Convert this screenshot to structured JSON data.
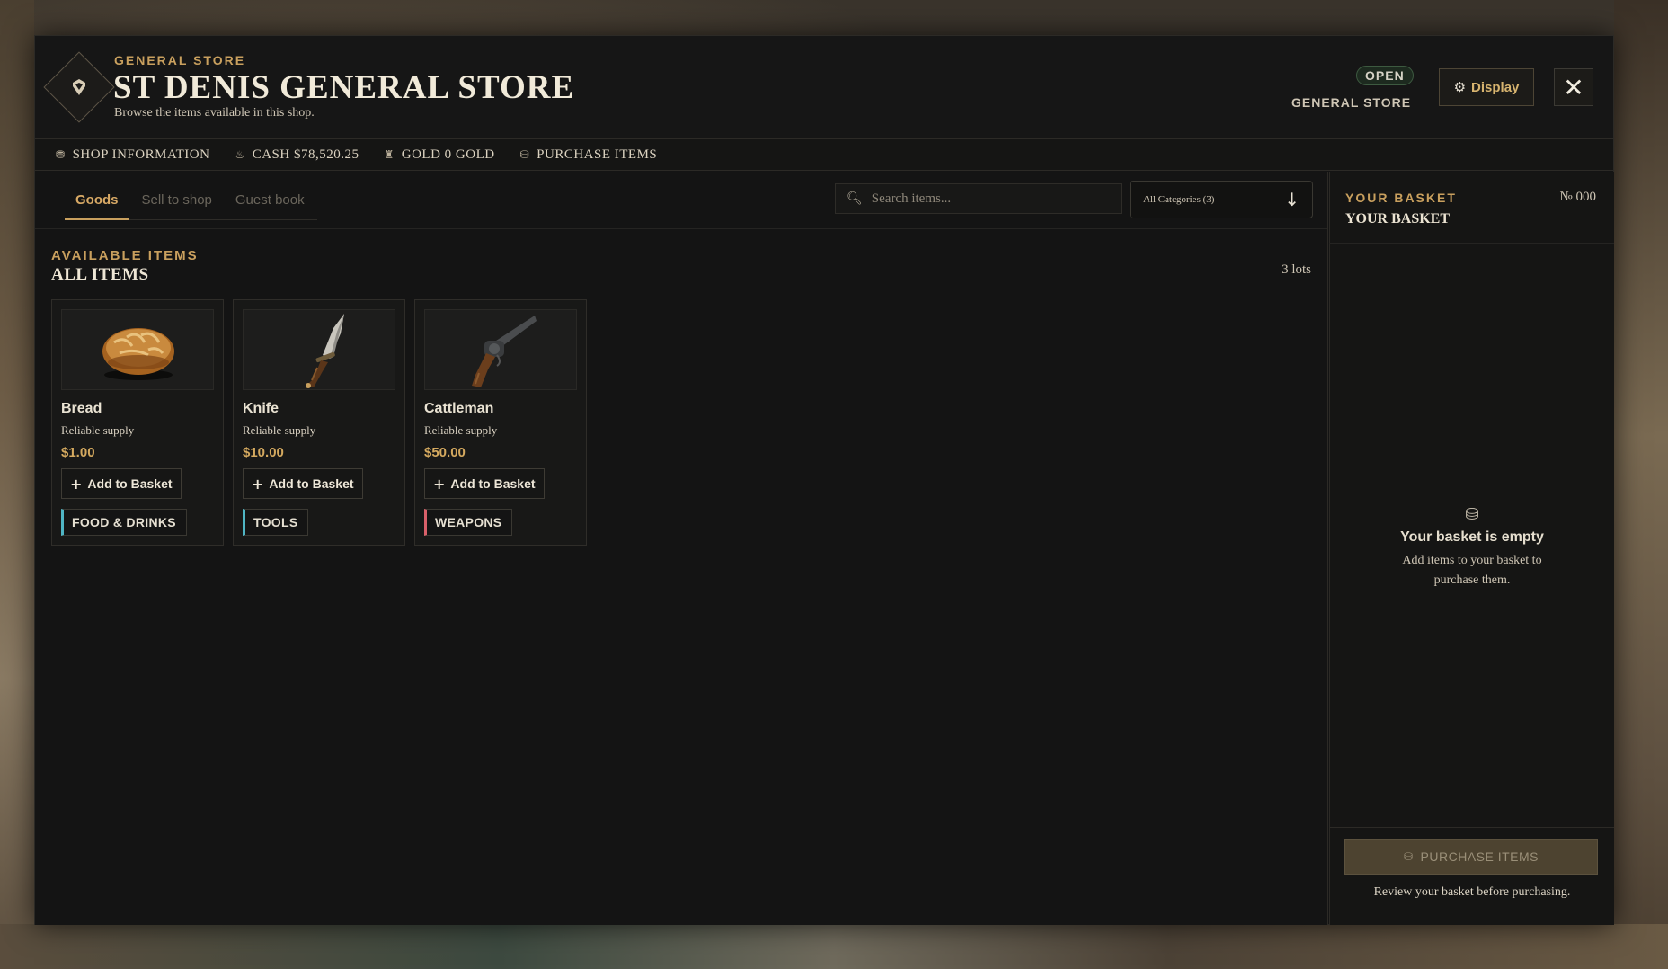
{
  "header": {
    "eyebrow": "GENERAL STORE",
    "title": "ST DENIS GENERAL STORE",
    "subtitle": "Browse the items available in this shop.",
    "status": "OPEN",
    "store_type": "GENERAL STORE",
    "display_label": "Display",
    "close_symbol": "✕"
  },
  "infobar": [
    {
      "icon": "shop-info-icon",
      "glyph": "⛃",
      "label": "SHOP INFORMATION"
    },
    {
      "icon": "cash-icon",
      "glyph": "♨",
      "label": "CASH $78,520.25"
    },
    {
      "icon": "gold-icon",
      "glyph": "♜",
      "label": "GOLD 0 GOLD"
    },
    {
      "icon": "purchase-icon",
      "glyph": "⛁",
      "label": "PURCHASE ITEMS"
    }
  ],
  "tabs": [
    {
      "label": "Goods",
      "active": true
    },
    {
      "label": "Sell to shop",
      "active": false
    },
    {
      "label": "Guest book",
      "active": false
    }
  ],
  "search": {
    "placeholder": "Search items..."
  },
  "category_select": {
    "value": "All Categories (3)"
  },
  "section": {
    "eyebrow": "AVAILABLE ITEMS",
    "title": "ALL ITEMS",
    "count": "3 lots"
  },
  "items": [
    {
      "name": "Bread",
      "desc": "Reliable supply",
      "price": "$1.00",
      "add_label": "Add to Basket",
      "category": "FOOD & DRINKS",
      "category_color": "#4fb5c4"
    },
    {
      "name": "Knife",
      "desc": "Reliable supply",
      "price": "$10.00",
      "add_label": "Add to Basket",
      "category": "TOOLS",
      "category_color": "#4fb5c4"
    },
    {
      "name": "Cattleman",
      "desc": "Reliable supply",
      "price": "$50.00",
      "add_label": "Add to Basket",
      "category": "WEAPONS",
      "category_color": "#d9606a"
    }
  ],
  "basket": {
    "eyebrow": "YOUR BASKET",
    "number": "№ 000",
    "title": "YOUR BASKET",
    "empty_title": "Your basket is empty",
    "empty_sub": "Add items to your basket to purchase them.",
    "purchase_label": "PURCHASE ITEMS",
    "purchase_note": "Review your basket before purchasing."
  },
  "colors": {
    "accent": "#c9a05e",
    "panel": "#141414"
  }
}
